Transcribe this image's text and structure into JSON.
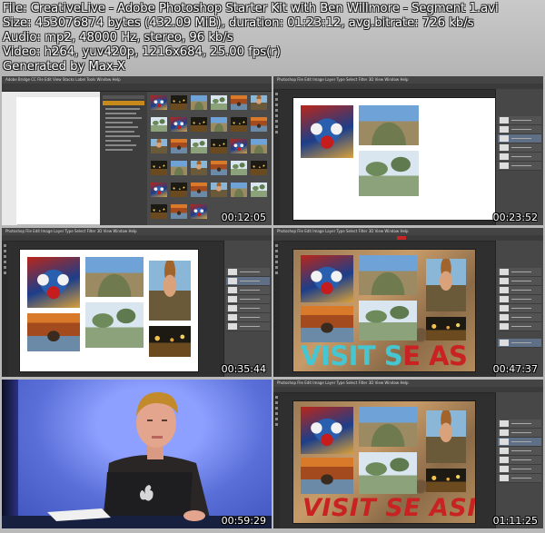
{
  "header": {
    "file_line": "File: CreativeLive - Adobe Photoshop Starter Kit with Ben Willmore - Segment 1.avi",
    "size_line": "Size: 453076874 bytes (432.09 MiB), duration: 01:23:12, avg.bitrate: 726 kb/s",
    "audio_line": "Audio: mp2, 48000 Hz, stereo, 96 kb/s",
    "video_line": "Video: h264, yuv420p, 1216x684, 25.00 fps(r)",
    "generated_line": "Generated by Max-X"
  },
  "thumbnails": [
    {
      "timestamp": "00:12:05",
      "app_menu": "Adobe Bridge CC  File  Edit  View  Stacks  Label  Tools  Window  Help"
    },
    {
      "timestamp": "00:23:52",
      "app_menu": "Photoshop  File  Edit  Image  Layer  Type  Select  Filter  3D  View  Window  Help"
    },
    {
      "timestamp": "00:35:44",
      "app_menu": "Photoshop  File  Edit  Image  Layer  Type  Select  Filter  3D  View  Window  Help"
    },
    {
      "timestamp": "00:47:37",
      "app_menu": "Photoshop  File  Edit  Image  Layer  Type  Select  Filter  3D  View  Window  Help"
    },
    {
      "timestamp": "00:59:29",
      "app_menu": ""
    },
    {
      "timestamp": "01:11:25",
      "app_menu": "Photoshop  File  Edit  Image  Layer  Type  Select  Filter  3D  View  Window  Help"
    }
  ],
  "poster_text": {
    "thumb4_white": "VISIT S",
    "thumb4_red": "E AS",
    "thumb6": "VISIT SE ASIA"
  },
  "colors": {
    "photoshop_ui": "#2f2f2f",
    "poster_cyan": "#46c6d1",
    "poster_red": "#c82222",
    "studio_blue": "#5a6fd8"
  }
}
